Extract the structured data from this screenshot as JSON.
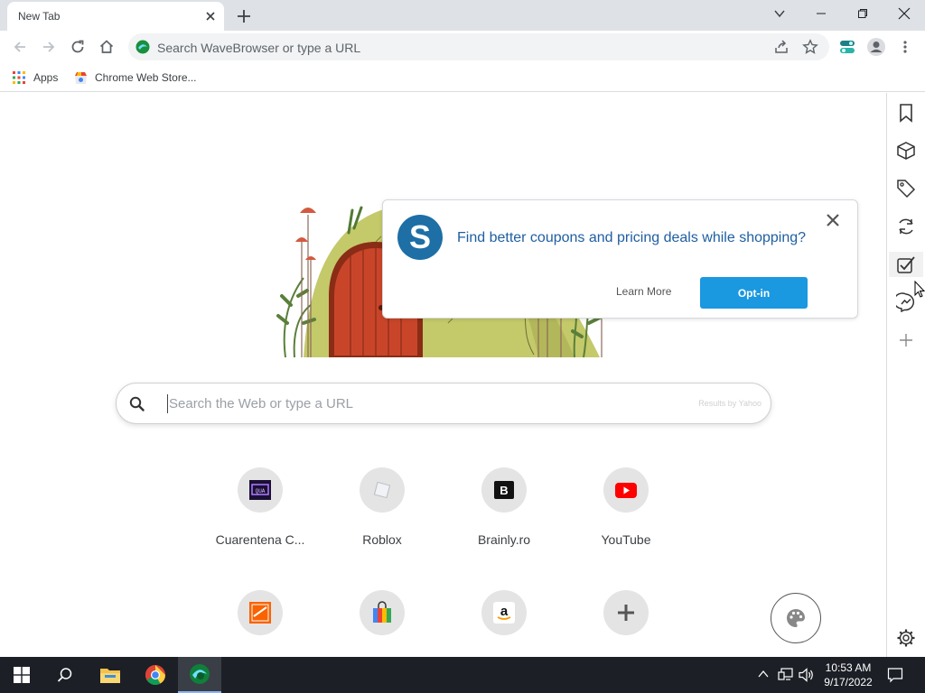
{
  "tab": {
    "title": "New Tab"
  },
  "omnibox": {
    "placeholder": "Search WaveBrowser or type a URL"
  },
  "bookmarks": [
    {
      "label": "Apps"
    },
    {
      "label": "Chrome Web Store..."
    }
  ],
  "popup": {
    "message": "Find better coupons and pricing deals while shopping?",
    "learn_more": "Learn More",
    "optin": "Opt-in",
    "accent": "#1a98e0"
  },
  "search": {
    "placeholder": "Search the Web or type a URL",
    "credit": "Results by Yahoo"
  },
  "shortcuts": [
    {
      "label": "Cuarentena C...",
      "icon": "twitch-style-icon"
    },
    {
      "label": "Roblox",
      "icon": "roblox-icon"
    },
    {
      "label": "Brainly.ro",
      "icon": "brainly-icon"
    },
    {
      "label": "YouTube",
      "icon": "youtube-icon"
    },
    {
      "label": "",
      "icon": "home-depot-icon"
    },
    {
      "label": "",
      "icon": "shopping-bag-icon"
    },
    {
      "label": "",
      "icon": "amazon-icon"
    },
    {
      "label": "",
      "icon": "add-shortcut-icon"
    }
  ],
  "sidebar": [
    "bookmark-icon",
    "box-icon",
    "tag-icon",
    "sync-icon",
    "checklist-icon",
    "messenger-icon",
    "add-icon",
    "settings-icon"
  ],
  "taskbar": {
    "time": "10:53 AM",
    "date": "9/17/2022"
  }
}
